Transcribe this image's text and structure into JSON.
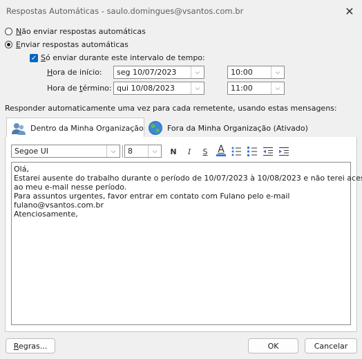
{
  "window": {
    "title": "Respostas Automáticas - saulo.domingues@vsantos.com.br",
    "close_glyph": "✕"
  },
  "options": {
    "no_reply_label": "Não enviar respostas automáticas",
    "send_reply_label": "Enviar respostas automáticas",
    "selected": "send_reply",
    "only_interval_label": "Só enviar durante este intervalo de tempo:",
    "only_interval_checked": true
  },
  "schedule": {
    "start_label": "Hora de início:",
    "start_date": "seg 10/07/2023",
    "start_time": "10:00",
    "end_label": "Hora de término:",
    "end_date": "qui 10/08/2023",
    "end_time": "11:00"
  },
  "instruction": "Responder automaticamente uma vez para cada remetente, usando estas mensagens:",
  "tabs": [
    {
      "label": "Dentro da Minha Organização",
      "active": true,
      "icon": "people-icon"
    },
    {
      "label": "Fora da Minha Organização (Ativado)",
      "active": false,
      "icon": "globe-icon"
    }
  ],
  "formatting": {
    "font_name": "Segoe UI",
    "font_size": "8",
    "bold": "N",
    "italic": "I",
    "underline": "S",
    "font_color": "A",
    "accent_color": "#3a74c8"
  },
  "message": {
    "lines": [
      "Olá,",
      "",
      "Estarei ausente do trabalho durante o período de 10/07/2023 à 10/08/2023 e não terei acesso",
      "ao meu e-mail nesse período.",
      "Para assuntos urgentes, favor entrar em contato com Fulano pelo e-mail",
      "fulano@vsantos.com.br",
      "",
      "Atenciosamente,"
    ]
  },
  "buttons": {
    "rules": "Regras...",
    "ok": "OK",
    "cancel": "Cancelar"
  }
}
